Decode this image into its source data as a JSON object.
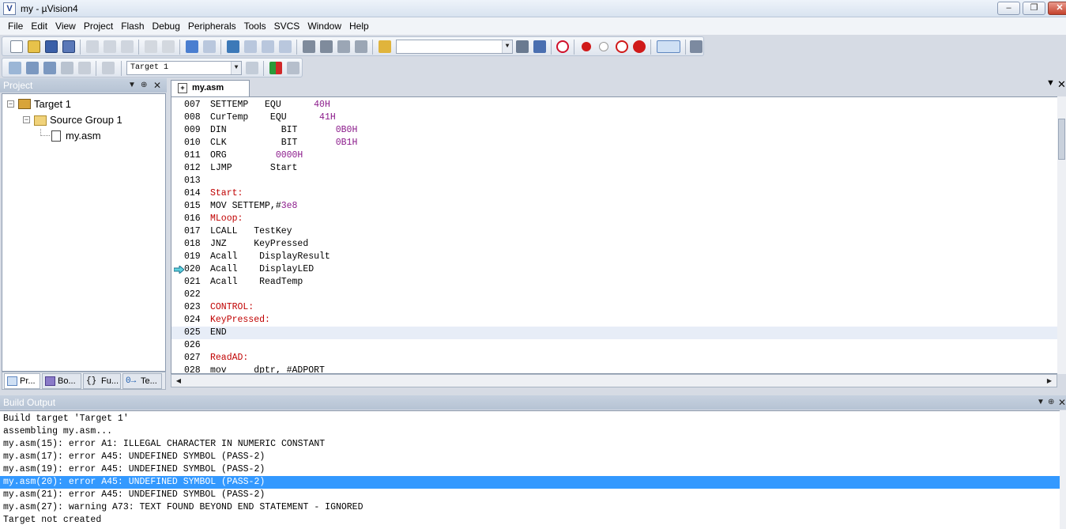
{
  "window": {
    "title": "my  - µVision4",
    "app_icon": "uvision-logo-icon"
  },
  "menu": [
    "File",
    "Edit",
    "View",
    "Project",
    "Flash",
    "Debug",
    "Peripherals",
    "Tools",
    "SVCS",
    "Window",
    "Help"
  ],
  "toolbar": {
    "target_select": "Target 1",
    "find_combo": ""
  },
  "project_panel": {
    "title": "Project",
    "tree": [
      {
        "label": "Target 1",
        "level": 0,
        "icon": "target-icon"
      },
      {
        "label": "Source Group 1",
        "level": 1,
        "icon": "folder-icon"
      },
      {
        "label": "my.asm",
        "level": 2,
        "icon": "asm-file-icon"
      }
    ],
    "tabs": [
      "Pr...",
      "Bo...",
      "Fu...",
      "Te..."
    ]
  },
  "editor": {
    "tab": "my.asm",
    "current_line": "025",
    "pc_line": "020",
    "lines": [
      {
        "n": "007",
        "tokens": [
          {
            "t": "SETTEMP   ",
            "c": "kw"
          },
          {
            "t": "EQU      ",
            "c": "kw"
          },
          {
            "t": "40H",
            "c": "num"
          }
        ]
      },
      {
        "n": "008",
        "tokens": [
          {
            "t": "CurTemp    ",
            "c": "kw"
          },
          {
            "t": "EQU      ",
            "c": "kw"
          },
          {
            "t": "41H",
            "c": "num"
          }
        ]
      },
      {
        "n": "009",
        "tokens": [
          {
            "t": "DIN          ",
            "c": "kw"
          },
          {
            "t": "BIT       ",
            "c": "kw"
          },
          {
            "t": "0B0H",
            "c": "num"
          }
        ]
      },
      {
        "n": "010",
        "tokens": [
          {
            "t": "CLK          ",
            "c": "kw"
          },
          {
            "t": "BIT       ",
            "c": "kw"
          },
          {
            "t": "0B1H",
            "c": "num"
          }
        ]
      },
      {
        "n": "011",
        "tokens": [
          {
            "t": "ORG         ",
            "c": "kw"
          },
          {
            "t": "0000H",
            "c": "num"
          }
        ]
      },
      {
        "n": "012",
        "tokens": [
          {
            "t": "LJMP       Start",
            "c": "kw"
          }
        ]
      },
      {
        "n": "013",
        "tokens": []
      },
      {
        "n": "014",
        "tokens": [
          {
            "t": "Start:",
            "c": "lbl"
          }
        ]
      },
      {
        "n": "015",
        "tokens": [
          {
            "t": "MOV SETTEMP,#",
            "c": "kw"
          },
          {
            "t": "3e8",
            "c": "num"
          }
        ]
      },
      {
        "n": "016",
        "tokens": [
          {
            "t": "MLoop:",
            "c": "lbl"
          }
        ]
      },
      {
        "n": "017",
        "tokens": [
          {
            "t": "LCALL   TestKey",
            "c": "kw"
          }
        ]
      },
      {
        "n": "018",
        "tokens": [
          {
            "t": "JNZ     KeyPressed",
            "c": "kw"
          }
        ]
      },
      {
        "n": "019",
        "tokens": [
          {
            "t": "Acall    DisplayResult",
            "c": "kw"
          }
        ]
      },
      {
        "n": "020",
        "tokens": [
          {
            "t": "Acall    DisplayLED",
            "c": "kw"
          }
        ]
      },
      {
        "n": "021",
        "tokens": [
          {
            "t": "Acall    ReadTemp",
            "c": "kw"
          }
        ]
      },
      {
        "n": "022",
        "tokens": []
      },
      {
        "n": "023",
        "tokens": [
          {
            "t": "CONTROL:",
            "c": "lbl"
          }
        ]
      },
      {
        "n": "024",
        "tokens": [
          {
            "t": "KeyPressed:",
            "c": "lbl"
          }
        ]
      },
      {
        "n": "025",
        "tokens": [
          {
            "t": "END",
            "c": "kw"
          }
        ]
      },
      {
        "n": "026",
        "tokens": []
      },
      {
        "n": "027",
        "tokens": [
          {
            "t": "ReadAD:",
            "c": "lbl"
          }
        ]
      },
      {
        "n": "028",
        "tokens": [
          {
            "t": "mov     dptr, #ADPORT",
            "c": "kw"
          }
        ]
      }
    ]
  },
  "build_output": {
    "title": "Build Output",
    "selected_index": 5,
    "lines": [
      "Build target 'Target 1'",
      "assembling my.asm...",
      "my.asm(15): error A1: ILLEGAL CHARACTER IN NUMERIC CONSTANT",
      "my.asm(17): error A45: UNDEFINED SYMBOL (PASS-2)",
      "my.asm(19): error A45: UNDEFINED SYMBOL (PASS-2)",
      "my.asm(20): error A45: UNDEFINED SYMBOL (PASS-2)",
      "my.asm(21): error A45: UNDEFINED SYMBOL (PASS-2)",
      "my.asm(27): warning A73: TEXT FOUND BEYOND END STATEMENT - IGNORED",
      "Target not created"
    ]
  },
  "colors": {
    "selection": "#3399ff",
    "label": "#c00000",
    "number": "#8b1a8b"
  }
}
